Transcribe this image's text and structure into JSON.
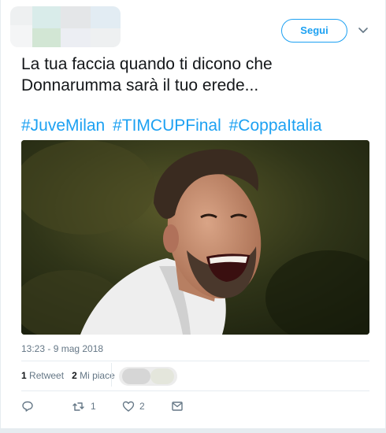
{
  "header": {
    "follow_label": "Segui",
    "menu_icon": "chevron-down-icon"
  },
  "tweet": {
    "text": "La tua faccia quando ti dicono che Donnarumma sarà il tuo erede...",
    "hashtags": [
      "#JuveMilan",
      "#TIMCUPFinal",
      "#CoppaItalia"
    ],
    "timestamp": "13:23 - 9 mag 2018"
  },
  "stats": {
    "retweet_count": "1",
    "retweet_label": "Retweet",
    "like_count": "2",
    "like_label": "Mi piace"
  },
  "actions": {
    "reply_icon": "reply-icon",
    "retweet_icon": "retweet-icon",
    "retweet_count": "1",
    "like_icon": "heart-icon",
    "like_count": "2",
    "message_icon": "envelope-icon"
  },
  "colors": {
    "accent": "#1da1f2",
    "text": "#14171a",
    "muted": "#657786",
    "border": "#e6ecf0"
  }
}
